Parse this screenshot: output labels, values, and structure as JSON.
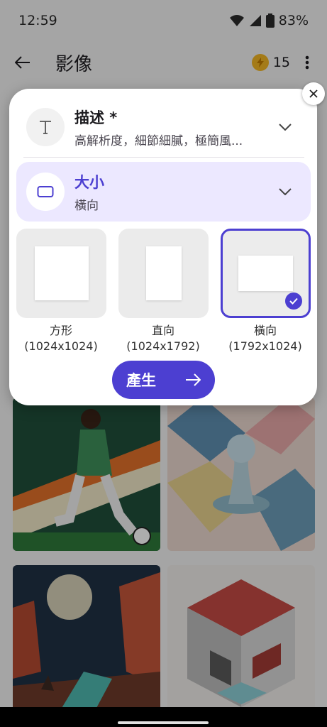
{
  "status": {
    "time": "12:59",
    "battery": "83%"
  },
  "appbar": {
    "title": "影像",
    "credits": "15"
  },
  "sheet": {
    "prompt": {
      "label": "描述 *",
      "value": "高解析度，細節細膩，極簡風..."
    },
    "size": {
      "label": "大小",
      "value": "橫向"
    },
    "options": [
      {
        "name": "方形",
        "dims": "(1024x1024)"
      },
      {
        "name": "直向",
        "dims": "(1024x1792)"
      },
      {
        "name": "橫向",
        "dims": "(1792x1024)"
      }
    ],
    "selected_option": "橫向",
    "generate_label": "產生"
  },
  "colors": {
    "accent": "#4c3fd1",
    "size_row_bg": "#ece8ff",
    "scrim": "#000000"
  },
  "icons": [
    "back-arrow-icon",
    "coin-icon",
    "more-vert-icon",
    "close-icon",
    "text-icon",
    "chevron-down-icon",
    "aspect-ratio-icon",
    "check-icon",
    "arrow-right-icon",
    "wifi-icon",
    "cell-signal-icon",
    "battery-icon"
  ]
}
